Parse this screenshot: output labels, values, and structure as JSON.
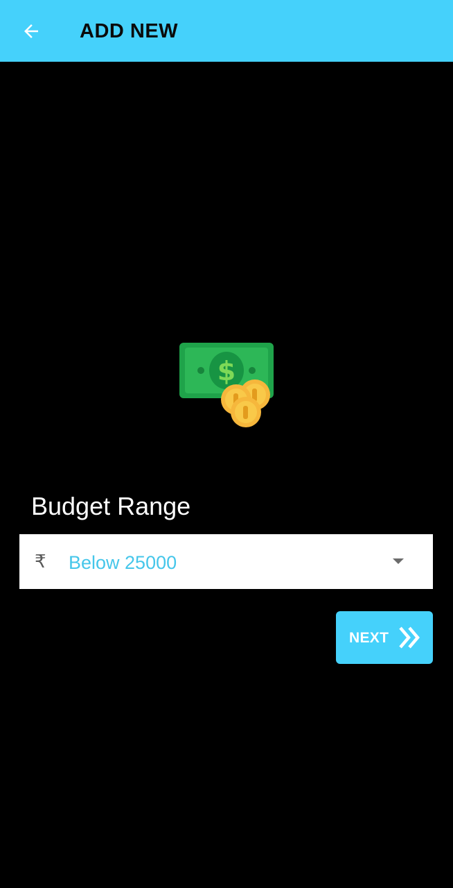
{
  "header": {
    "title": "ADD NEW",
    "back_icon": "arrow-left-icon",
    "background_color": "#45d1fb"
  },
  "main": {
    "illustration_icon": "money-cash-coins-icon",
    "budget": {
      "label": "Budget Range",
      "currency_icon": "rupee-icon",
      "currency_symbol": "₹",
      "selected_value": "Below 25000",
      "dropdown_icon": "caret-down-icon",
      "value_color": "#45c6ea"
    },
    "next_button": {
      "label": "NEXT",
      "icon": "double-chevron-right-icon",
      "color": "#45d1fb"
    }
  }
}
